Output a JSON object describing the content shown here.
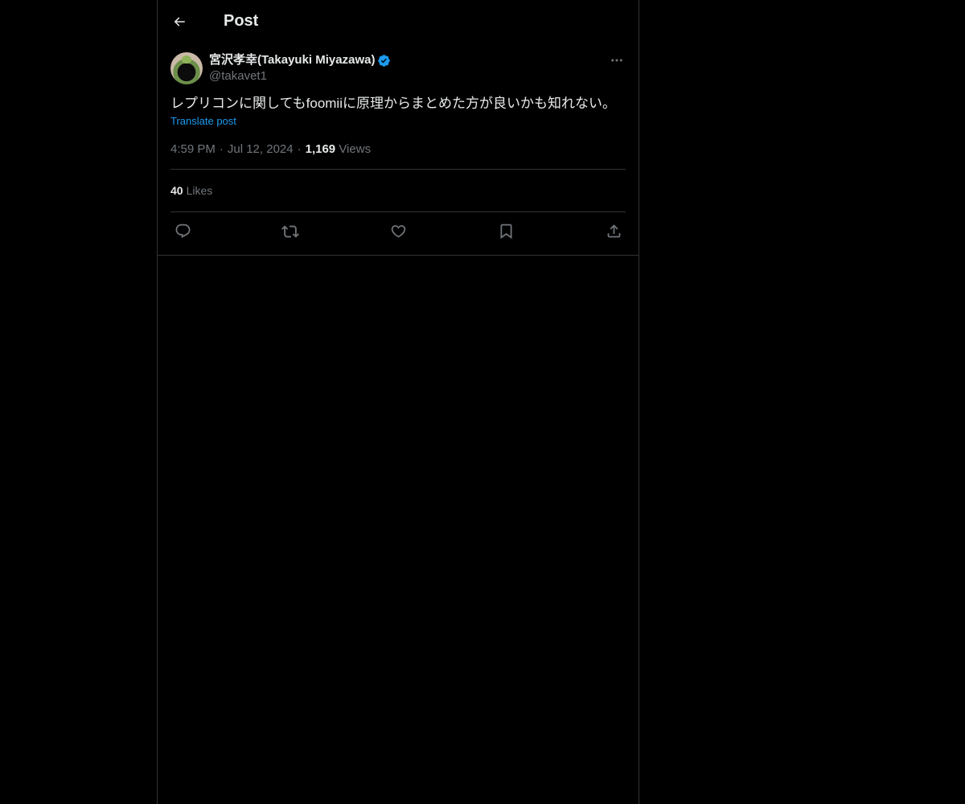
{
  "header": {
    "title": "Post",
    "back_icon": "arrow-left-icon"
  },
  "post": {
    "author": {
      "display_name": "宮沢孝幸(Takayuki Miyazawa)",
      "handle": "@takavet1",
      "verified": true,
      "verified_color": "#1d9bf0"
    },
    "text": "レプリコンに関してもfoomiiに原理からまとめた方が良いかも知れない。",
    "translate_label": "Translate post",
    "time": "4:59 PM",
    "date": "Jul 12, 2024",
    "separator": "·",
    "views_count": "1,169",
    "views_label": "Views",
    "likes_count": "40",
    "likes_label": "Likes"
  },
  "actions": [
    {
      "name": "reply",
      "icon": "reply-icon"
    },
    {
      "name": "repost",
      "icon": "repost-icon"
    },
    {
      "name": "like",
      "icon": "heart-icon"
    },
    {
      "name": "bookmark",
      "icon": "bookmark-icon"
    },
    {
      "name": "share",
      "icon": "share-icon"
    }
  ],
  "colors": {
    "background": "#000000",
    "text": "#e7e9ea",
    "muted": "#71767b",
    "border": "#2f3336",
    "accent": "#1d9bf0"
  }
}
